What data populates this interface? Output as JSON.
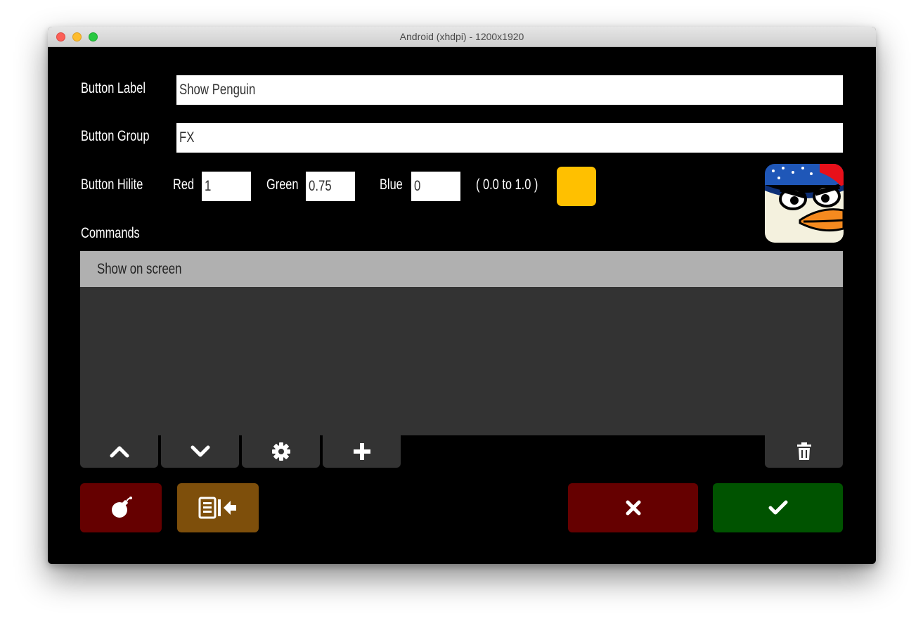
{
  "window": {
    "title": "Android (xhdpi) - 1200x1920"
  },
  "form": {
    "label_caption": "Button Label",
    "label_value": "Show Penguin",
    "group_caption": "Button Group",
    "group_value": "FX",
    "hilite_caption": "Button Hilite",
    "red_caption": "Red",
    "red_value": "1",
    "green_caption": "Green",
    "green_value": "0.75",
    "blue_caption": "Blue",
    "blue_value": "0",
    "range_hint": "( 0.0 to 1.0 )",
    "hilite_color": "#ffc000",
    "commands_caption": "Commands"
  },
  "commands": {
    "items": [
      "Show on screen"
    ]
  },
  "toolbar": {
    "icons": [
      "chevron-up-icon",
      "chevron-down-icon",
      "gear-icon",
      "plus-icon",
      "trash-icon"
    ]
  },
  "actions": {
    "bomb_color": "#650000",
    "import_color": "#7e4f0b",
    "cancel_color": "#650000",
    "confirm_color": "#005300"
  }
}
